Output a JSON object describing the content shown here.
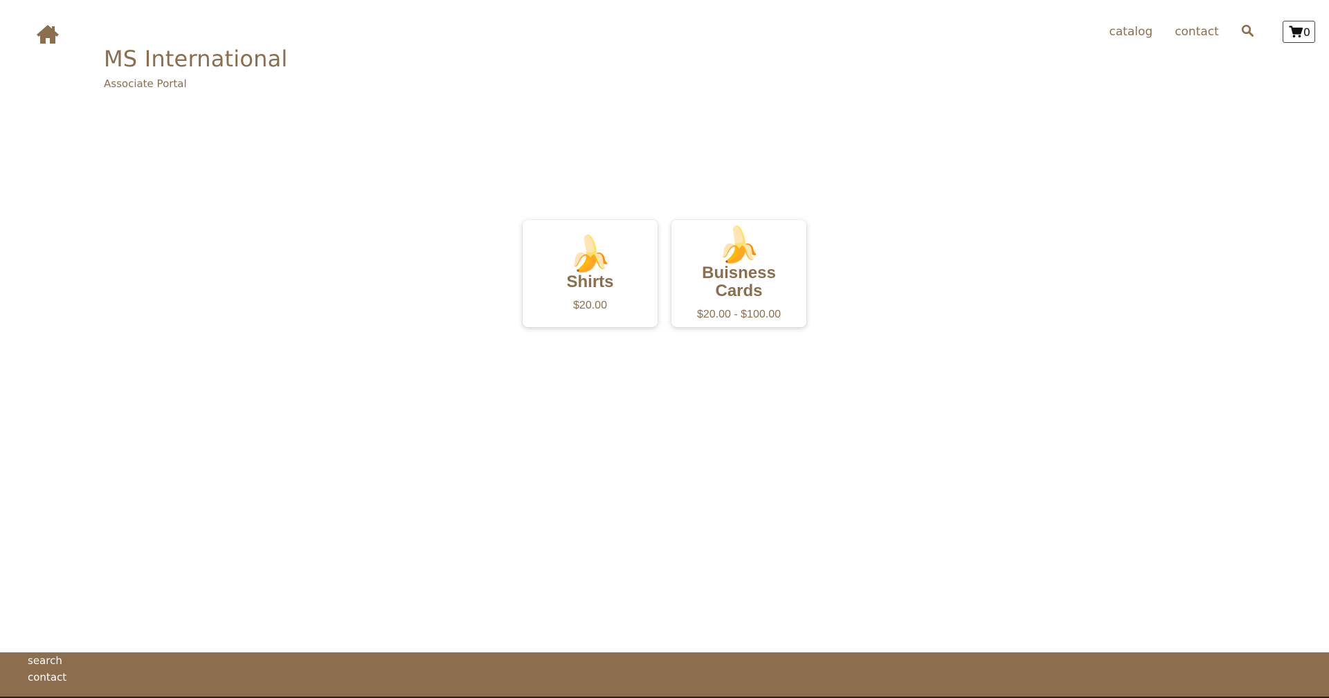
{
  "header": {
    "brand_title": "MS International",
    "brand_subtitle": "Associate Portal",
    "home_icon": "home-icon"
  },
  "nav": {
    "catalog_label": "catalog",
    "contact_label": "contact",
    "search_icon": "search-icon",
    "cart_icon": "cart-icon",
    "cart_count": "0"
  },
  "products": [
    {
      "thumb": "🍌",
      "name": "Shirts",
      "price": "$20.00"
    },
    {
      "thumb": "🍌",
      "name": "Buisness Cards",
      "price": "$20.00 - $100.00"
    }
  ],
  "footer": {
    "links": [
      "search",
      "contact"
    ]
  },
  "colors": {
    "brand": "#8b6e4e",
    "footer_bg": "#8c6e4e",
    "background": "#ffffff"
  }
}
